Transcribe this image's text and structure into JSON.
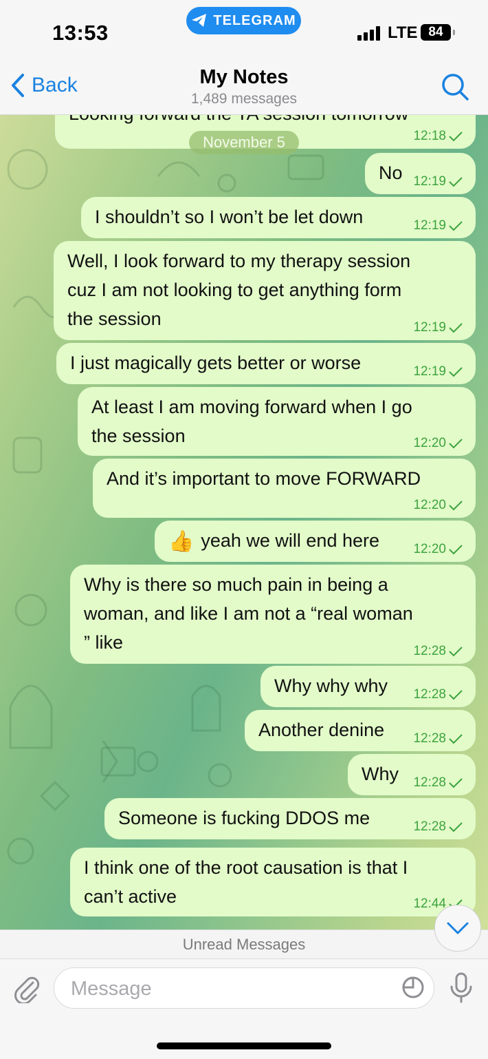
{
  "status_bar": {
    "time": "13:53",
    "app_pill": "TELEGRAM",
    "network": "LTE",
    "battery": "84"
  },
  "header": {
    "back_label": "Back",
    "title": "My Notes",
    "subtitle": "1,489 messages",
    "search_icon": "search-icon"
  },
  "chat": {
    "partial_message": {
      "text": "Looking forward the TA session tomorrow",
      "time": "12:18"
    },
    "date_separator": "November 5",
    "messages": [
      {
        "text": "No",
        "time": "12:19"
      },
      {
        "text": "I shouldn’t so I won’t be let down",
        "time": "12:19"
      },
      {
        "lines": [
          "Well, I look forward to my therapy session",
          "cuz I am not looking to get anything form",
          "the session"
        ],
        "time": "12:19"
      },
      {
        "text": "I just magically gets better or worse",
        "time": "12:19"
      },
      {
        "lines": [
          "At least I am moving forward when I go",
          "the session"
        ],
        "time": "12:20"
      },
      {
        "text": "And it’s important to move FORWARD",
        "time": "12:20"
      },
      {
        "emoji": "👍",
        "text": "yeah we will end here",
        "time": "12:20"
      },
      {
        "lines": [
          "Why is there so much pain in being a",
          "woman, and like I am not a “real woman",
          "” like"
        ],
        "time": "12:28"
      },
      {
        "text": "Why why why",
        "time": "12:28"
      },
      {
        "text": "Another denine",
        "time": "12:28"
      },
      {
        "text": "Why",
        "time": "12:28"
      },
      {
        "text": "Someone is fucking DDOS me",
        "time": "12:28"
      },
      {
        "lines": [
          "I think one of the root causation is that I",
          "can’t active"
        ],
        "time": "12:44"
      }
    ]
  },
  "unread_label": "Unread Messages",
  "input": {
    "placeholder": "Message"
  },
  "colors": {
    "bubble": "#e2fbc9",
    "timestamp": "#3da33e",
    "accent": "#1a82e0"
  }
}
